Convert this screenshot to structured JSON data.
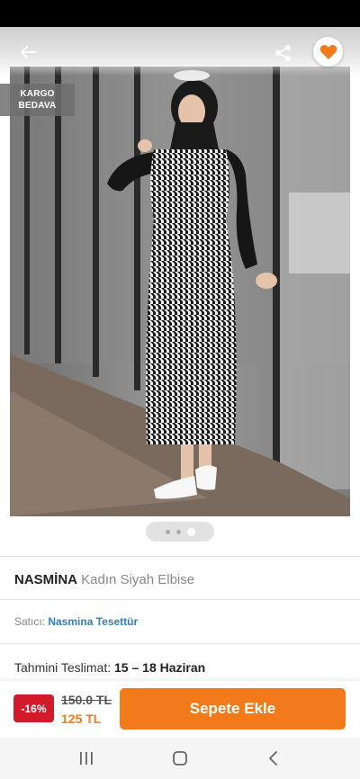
{
  "header": {
    "back_icon": "arrow-left-icon",
    "share_icon": "share-icon",
    "favorite_icon": "heart-icon",
    "favorite_color": "#f27a1a"
  },
  "badge": {
    "line1": "KARGO",
    "line2": "BEDAVA"
  },
  "gallery": {
    "image_count": 3,
    "active_index": 2
  },
  "product": {
    "brand": "NASMİNA",
    "name": "Kadın Siyah Elbise"
  },
  "seller": {
    "label": "Satıcı:",
    "name": "Nasmina Tesettür"
  },
  "delivery": {
    "label": "Tahmini Teslimat:",
    "dates": "15 – 18 Haziran"
  },
  "purchase": {
    "discount": "-16%",
    "old_price": "150.0 TL",
    "new_price": "125 TL",
    "add_to_cart": "Sepete Ekle",
    "accent_color": "#f27a1a",
    "discount_color": "#d31a2b"
  },
  "system_nav": {
    "recents_icon": "recents-icon",
    "home_icon": "home-icon",
    "back_icon": "back-chevron-icon"
  }
}
